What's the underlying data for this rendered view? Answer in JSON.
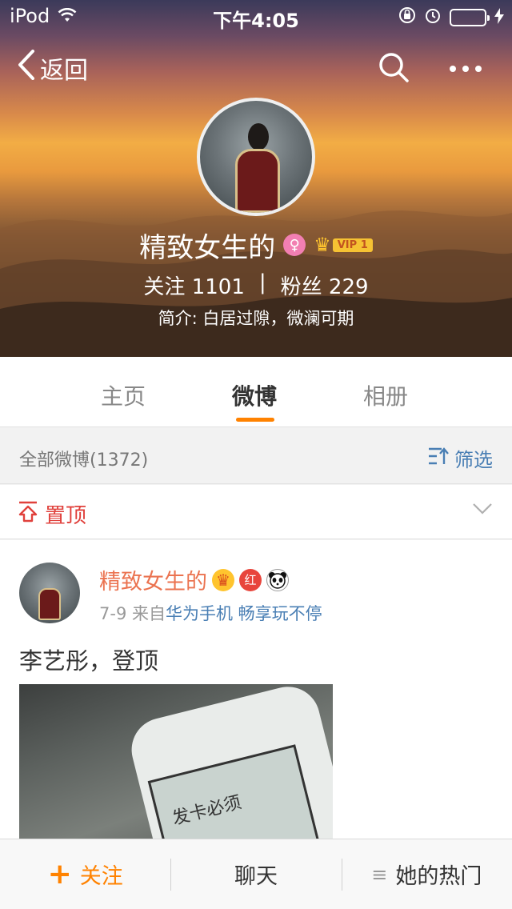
{
  "status_bar": {
    "carrier": "iPod",
    "time": "下午4:05",
    "battery_level": 1.0,
    "icons": [
      "wifi-icon",
      "orientation-lock-icon",
      "alarm-icon",
      "battery-icon",
      "charging-icon"
    ]
  },
  "nav": {
    "back_label": "返回",
    "icons": [
      "back-chevron-icon",
      "search-icon",
      "more-icon"
    ]
  },
  "profile": {
    "name": "精致女生的",
    "gender_symbol": "♀",
    "vip_label": "VIP 1",
    "following_label": "关注",
    "following_count": "1101",
    "separator": "|",
    "followers_label": "粉丝",
    "followers_count": "229",
    "bio": "简介: 白居过隙，微澜可期"
  },
  "tabs": [
    {
      "label": "主页",
      "active": false
    },
    {
      "label": "微博",
      "active": true
    },
    {
      "label": "相册",
      "active": false
    }
  ],
  "filter": {
    "count_label": "全部微博(1372)",
    "filter_label": "筛选"
  },
  "pinned": {
    "label": "置顶"
  },
  "post": {
    "author": "精致女生的",
    "badge_red": "红",
    "date": "7-9",
    "source_prefix": "来自",
    "source": "华为手机 畅享玩不停",
    "text": "李艺彤，登顶",
    "image_caption": "发卡必须"
  },
  "bottom_bar": {
    "follow_plus": "+",
    "follow_label": "关注",
    "chat_label": "聊天",
    "hot_icon": "≡",
    "hot_label": "她的热门"
  },
  "colors": {
    "accent_orange": "#ff8200",
    "name_orange": "#eb7350",
    "link_blue": "#4a7fb4",
    "pinned_red": "#e0413c",
    "battery_green": "#4cd964"
  }
}
